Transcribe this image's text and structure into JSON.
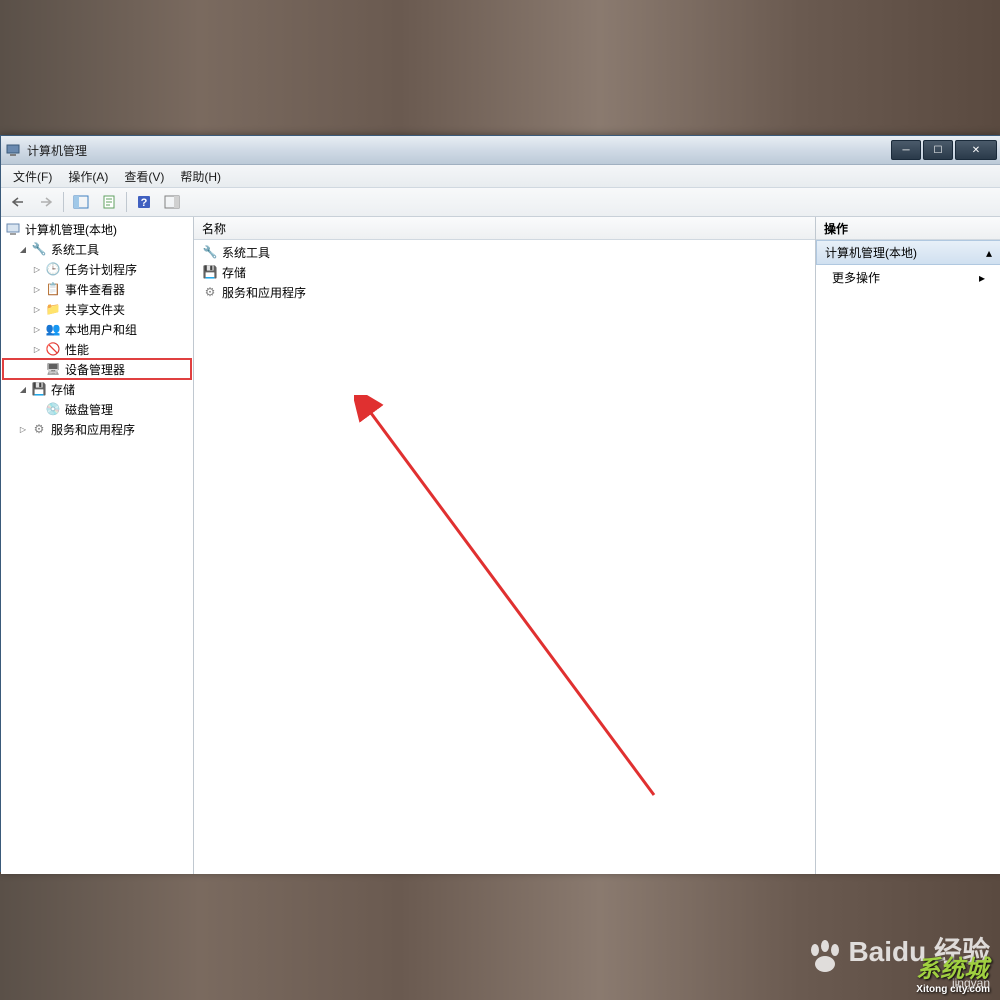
{
  "window": {
    "title": "计算机管理"
  },
  "menubar": {
    "file": "文件(F)",
    "action": "操作(A)",
    "view": "查看(V)",
    "help": "帮助(H)"
  },
  "tree": {
    "root": "计算机管理(本地)",
    "system_tools": "系统工具",
    "task_scheduler": "任务计划程序",
    "event_viewer": "事件查看器",
    "shared_folders": "共享文件夹",
    "local_users": "本地用户和组",
    "performance": "性能",
    "device_manager": "设备管理器",
    "storage": "存储",
    "disk_management": "磁盘管理",
    "services_apps": "服务和应用程序"
  },
  "list": {
    "header_name": "名称",
    "item_system_tools": "系统工具",
    "item_storage": "存储",
    "item_services": "服务和应用程序"
  },
  "actions": {
    "header": "操作",
    "group_title": "计算机管理(本地)",
    "more_actions": "更多操作"
  },
  "watermark": {
    "brand": "Baidu 经验",
    "sub": "jingyan",
    "brand2": "系统城",
    "brand2sub": "Xitong city.com"
  }
}
